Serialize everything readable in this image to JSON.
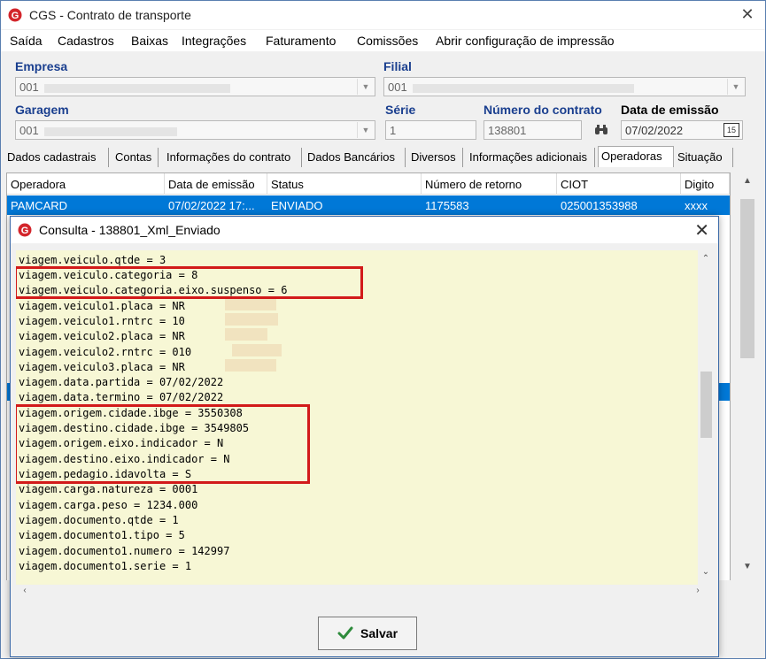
{
  "window": {
    "title": "CGS - Contrato de transporte",
    "close_icon": "close-icon"
  },
  "menu": [
    "Saída",
    "Cadastros",
    "Baixas",
    "Integrações",
    "Faturamento",
    "Comissões",
    "Abrir configuração de impressão"
  ],
  "form": {
    "empresa_label": "Empresa",
    "empresa_value": "001",
    "filial_label": "Filial",
    "filial_value": "001",
    "garagem_label": "Garagem",
    "garagem_value": "001",
    "serie_label": "Série",
    "serie_value": "1",
    "numero_label": "Número do contrato",
    "numero_value": "138801",
    "data_label": "Data de emissão",
    "data_value": "07/02/2022"
  },
  "tabs": [
    "Dados cadastrais",
    "Contas",
    "Informações do contrato",
    "Dados Bancários",
    "Diversos",
    "Informações adicionais",
    "Operadoras",
    "Situação"
  ],
  "active_tab": "Operadoras",
  "grid": {
    "columns": [
      "Operadora",
      "Data de emissão",
      "Status",
      "Número de retorno",
      "CIOT",
      "Digito"
    ],
    "rows": [
      [
        "PAMCARD",
        "07/02/2022 17:...",
        "ENVIADO",
        "1175583",
        "025001353988",
        "xxxx"
      ]
    ]
  },
  "dialog": {
    "title": "Consulta - 138801_Xml_Enviado",
    "lines": [
      "viagem.veiculo.qtde = 3",
      "viagem.veiculo.categoria = 8",
      "viagem.veiculo.categoria.eixo.suspenso = 6",
      "viagem.veiculo1.placa = NR",
      "viagem.veiculo1.rntrc = 10",
      "viagem.veiculo2.placa = NR",
      "viagem.veiculo2.rntrc = 010",
      "viagem.veiculo3.placa = NR",
      "viagem.data.partida = 07/02/2022",
      "viagem.data.termino = 07/02/2022",
      "viagem.origem.cidade.ibge = 3550308",
      "viagem.destino.cidade.ibge = 3549805",
      "viagem.origem.eixo.indicador = N",
      "viagem.destino.eixo.indicador = N",
      "viagem.pedagio.idavolta = S",
      "viagem.carga.natureza = 0001",
      "viagem.carga.peso = 1234.000",
      "viagem.documento.qtde = 1",
      "viagem.documento1.tipo = 5",
      "viagem.documento1.numero = 142997",
      "viagem.documento1.serie = 1"
    ],
    "save_label": "Salvar"
  },
  "colors": {
    "accent": "#0078d7",
    "label": "#1a3f8f",
    "highlight": "#d21a1a",
    "xml_bg": "#f7f7d5"
  }
}
